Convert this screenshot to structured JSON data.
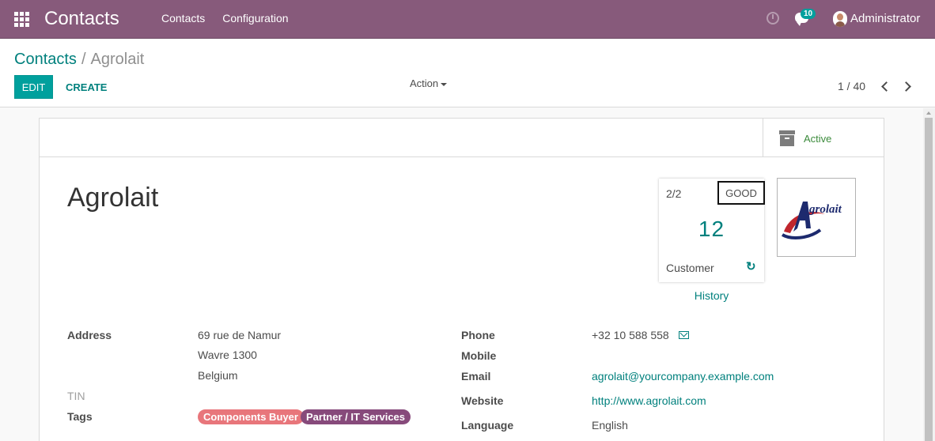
{
  "navbar": {
    "app_title": "Contacts",
    "menu": [
      "Contacts",
      "Configuration"
    ],
    "messages_badge": "10",
    "user_name": "Administrator",
    "icons": [
      "apps-icon",
      "clock-icon",
      "chat-icon",
      "avatar"
    ]
  },
  "breadcrumb": {
    "parent": "Contacts",
    "separator": "/",
    "current": "Agrolait"
  },
  "buttons": {
    "edit": "EDIT",
    "create": "CREATE",
    "action": "Action"
  },
  "pager": {
    "value": "1 / 40"
  },
  "smart_buttons": {
    "active_label": "Active"
  },
  "partner": {
    "name": "Agrolait"
  },
  "score_card": {
    "fraction": "2/2",
    "status": "GOOD",
    "value": "12",
    "type": "Customer",
    "history_link": "History"
  },
  "logo": {
    "text": "Agrolait",
    "accent": "#c0262d",
    "primary": "#1d2a6e"
  },
  "fields_left": {
    "address_label": "Address",
    "street": "69 rue de Namur",
    "city_zip": "Wavre  1300",
    "country": "Belgium",
    "tin_label": "TIN",
    "tags_label": "Tags",
    "tags": [
      "Components Buyer",
      "Partner / IT Services"
    ]
  },
  "fields_right": {
    "phone_label": "Phone",
    "phone": "+32 10 588 558",
    "mobile_label": "Mobile",
    "email_label": "Email",
    "email": "agrolait@yourcompany.example.com",
    "website_label": "Website",
    "website": "http://www.agrolait.com",
    "language_label": "Language",
    "language": "English"
  },
  "colors": {
    "navbar": "#875a7b",
    "primary": "#00a09d",
    "link": "#00807d",
    "tag_1": "#e8767b",
    "tag_2": "#874a7b"
  }
}
